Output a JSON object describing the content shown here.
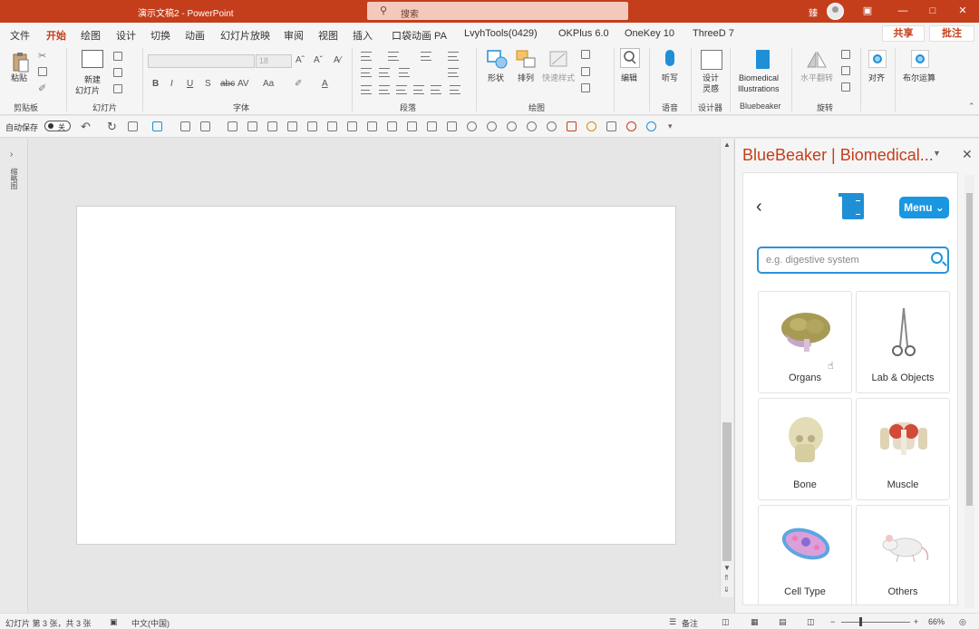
{
  "titlebar": {
    "title": "演示文稿2  -  PowerPoint",
    "search_placeholder": "搜索",
    "user_name": "臻",
    "ribbon_display_icon": "ribbon-display-icon",
    "minimize_icon": "minimize-icon",
    "maximize_icon": "maximize-icon",
    "close_icon": "close-icon"
  },
  "menu": {
    "tabs": [
      "文件",
      "开始",
      "绘图",
      "设计",
      "切换",
      "动画",
      "幻灯片放映",
      "审阅",
      "视图",
      "插入",
      "口袋动画 PA",
      "LvyhTools(0429)",
      "OKPlus 6.0",
      "OneKey 10",
      "ThreeD 7"
    ],
    "active_tab": "开始",
    "share_label": "共享",
    "comment_label": "批注"
  },
  "ribbon": {
    "paste_label": "粘贴",
    "new_slide_label_1": "新建",
    "new_slide_label_2": "幻灯片",
    "font_size_value": "18",
    "shape_label": "形状",
    "arrange_label": "排列",
    "quick_style_label": "快速样式",
    "edit_label": "编辑",
    "dictate_label": "听写",
    "designer_label_1": "设计",
    "designer_label_2": "灵感",
    "biomedical_label_1": "Biomedical",
    "biomedical_label_2": "Illustrations",
    "flip_label": "水平翻转",
    "align_label": "对齐",
    "boolean_label": "布尔运算",
    "groups": {
      "clipboard": "剪贴板",
      "slides": "幻灯片",
      "font": "字体",
      "paragraph": "段落",
      "drawing": "绘图",
      "voice": "语音",
      "designer": "设计器",
      "bluebeaker": "Bluebeaker",
      "rotate": "旋转"
    }
  },
  "qat": {
    "autosave_label": "自动保存",
    "autosave_state": "关"
  },
  "left_rail": {
    "label": "缩略图"
  },
  "pane": {
    "title": "BlueBeaker | Biomedical...",
    "menu_label": "Menu",
    "search_placeholder": "e.g. digestive system",
    "categories": [
      {
        "label": "Organs",
        "icon": "brain-icon"
      },
      {
        "label": "Lab & Objects",
        "icon": "forceps-icon"
      },
      {
        "label": "Bone",
        "icon": "skull-icon"
      },
      {
        "label": "Muscle",
        "icon": "torso-muscle-icon"
      },
      {
        "label": "Cell Type",
        "icon": "cell-icon"
      },
      {
        "label": "Others",
        "icon": "mouse-icon"
      }
    ]
  },
  "statusbar": {
    "slide_info": "幻灯片 第 3 张，共 3 张",
    "language": "中文(中国)",
    "notes_label": "备注",
    "zoom_level": "66%",
    "zoom_fraction": 0.27
  },
  "colors": {
    "accent": "#c43e1c",
    "pane_blue": "#1a97e0"
  }
}
